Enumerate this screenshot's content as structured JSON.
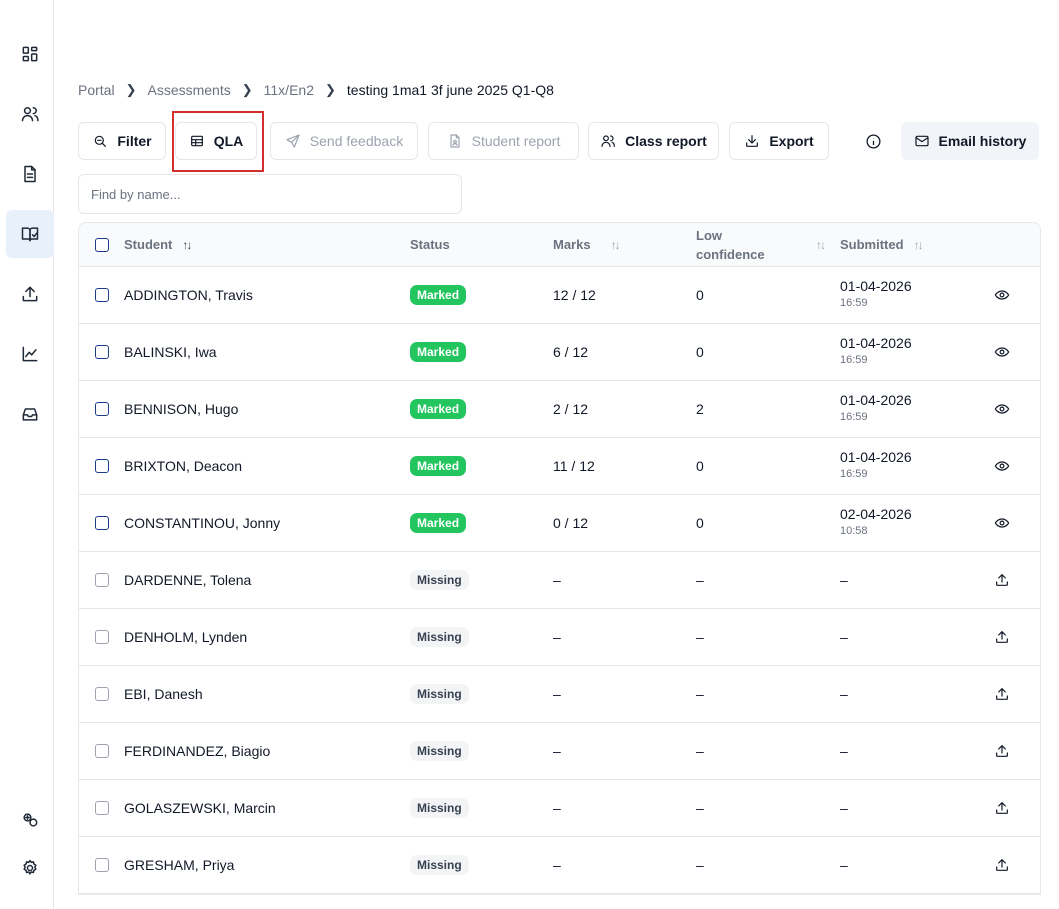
{
  "breadcrumb": [
    "Portal",
    "Assessments",
    "11x/En2",
    "testing 1ma1 3f june 2025 Q1-Q8"
  ],
  "toolbar": {
    "filter": "Filter",
    "qla": "QLA",
    "send_feedback": "Send feedback",
    "student_report": "Student report",
    "class_report": "Class report",
    "export": "Export",
    "email_history": "Email history"
  },
  "search": {
    "placeholder": "Find by name..."
  },
  "table": {
    "headers": {
      "student": "Student",
      "status": "Status",
      "marks": "Marks",
      "low_confidence_1": "Low",
      "low_confidence_2": "confidence",
      "submitted": "Submitted"
    },
    "rows": [
      {
        "name": "ADDINGTON, Travis",
        "status": "Marked",
        "marks": "12 / 12",
        "low": "0",
        "date": "01-04-2026",
        "time": "16:59",
        "action": "eye-icon"
      },
      {
        "name": "BALINSKI, Iwa",
        "status": "Marked",
        "marks": "6 / 12",
        "low": "0",
        "date": "01-04-2026",
        "time": "16:59",
        "action": "eye-icon"
      },
      {
        "name": "BENNISON, Hugo",
        "status": "Marked",
        "marks": "2 / 12",
        "low": "2",
        "date": "01-04-2026",
        "time": "16:59",
        "action": "eye-icon"
      },
      {
        "name": "BRIXTON, Deacon",
        "status": "Marked",
        "marks": "11 / 12",
        "low": "0",
        "date": "01-04-2026",
        "time": "16:59",
        "action": "eye-icon"
      },
      {
        "name": "CONSTANTINOU, Jonny",
        "status": "Marked",
        "marks": "0 / 12",
        "low": "0",
        "date": "02-04-2026",
        "time": "10:58",
        "action": "eye-icon"
      },
      {
        "name": "DARDENNE, Tolena",
        "status": "Missing",
        "marks": "–",
        "low": "–",
        "date": "–",
        "time": "",
        "action": "upload-icon"
      },
      {
        "name": "DENHOLM, Lynden",
        "status": "Missing",
        "marks": "–",
        "low": "–",
        "date": "–",
        "time": "",
        "action": "upload-icon"
      },
      {
        "name": "EBI, Danesh",
        "status": "Missing",
        "marks": "–",
        "low": "–",
        "date": "–",
        "time": "",
        "action": "upload-icon"
      },
      {
        "name": "FERDINANDEZ, Biagio",
        "status": "Missing",
        "marks": "–",
        "low": "–",
        "date": "–",
        "time": "",
        "action": "upload-icon"
      },
      {
        "name": "GOLASZEWSKI, Marcin",
        "status": "Missing",
        "marks": "–",
        "low": "–",
        "date": "–",
        "time": "",
        "action": "upload-icon"
      },
      {
        "name": "GRESHAM, Priya",
        "status": "Missing",
        "marks": "–",
        "low": "–",
        "date": "–",
        "time": "",
        "action": "upload-icon"
      }
    ]
  },
  "sidebar": {
    "items": [
      "dashboard-icon",
      "users-icon",
      "document-icon",
      "assessment-book-icon",
      "upload-icon",
      "analytics-chart-icon",
      "inbox-icon",
      "integrations-icon",
      "settings-icon"
    ],
    "active": "assessment-book-icon"
  },
  "colors": {
    "marked_badge": "#22c55e",
    "highlight_box": "#d32f2f",
    "active_nav": "#e8f0fb"
  }
}
